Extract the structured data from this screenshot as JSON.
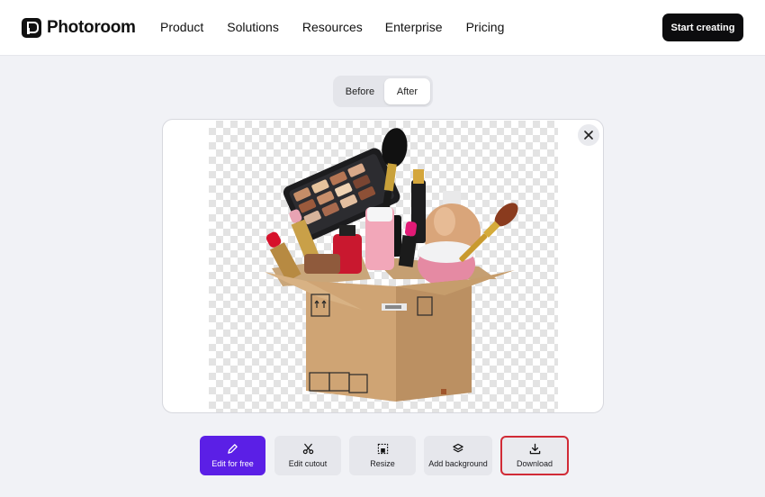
{
  "header": {
    "logo_text": "Photoroom",
    "nav": [
      "Product",
      "Solutions",
      "Resources",
      "Enterprise",
      "Pricing"
    ],
    "cta_label": "Start creating"
  },
  "toggle": {
    "before_label": "Before",
    "after_label": "After",
    "selected": "After"
  },
  "preview": {
    "subject": "makeup-box-image",
    "background": "transparent-checkerboard"
  },
  "actions": {
    "edit_label": "Edit for free",
    "edit_icon": "pencil-icon",
    "cutout_label": "Edit cutout",
    "cutout_icon": "scissors-icon",
    "resize_label": "Resize",
    "resize_icon": "resize-icon",
    "add_bg_label": "Add background",
    "add_bg_icon": "layers-icon",
    "download_label": "Download",
    "download_icon": "download-icon"
  },
  "colors": {
    "primary": "#5b1fe6",
    "highlight": "#d12b36",
    "cta": "#0c0c0e"
  }
}
